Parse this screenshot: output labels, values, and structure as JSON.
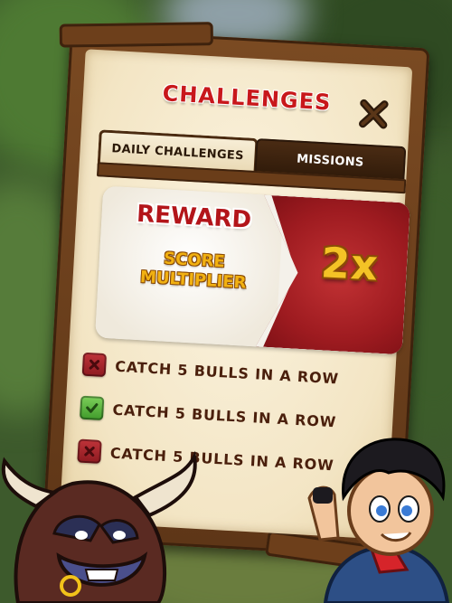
{
  "popup": {
    "title": "CHALLENGES",
    "close_icon": "close-x-icon"
  },
  "tabs": [
    {
      "label": "DAILY CHALLENGES",
      "active": true
    },
    {
      "label": "MISSIONS",
      "active": false
    }
  ],
  "reward": {
    "title": "REWARD",
    "description_line1": "SCORE",
    "description_line2": "MULTIPLIER",
    "multiplier": "2x"
  },
  "challenges": [
    {
      "text": "CATCH 5 BULLS IN A ROW",
      "status": "incomplete",
      "icon": "x-mark-icon"
    },
    {
      "text": "CATCH 5 BULLS IN A ROW",
      "status": "complete",
      "icon": "checkmark-icon"
    },
    {
      "text": "CATCH 5 BULLS IN A ROW",
      "status": "incomplete",
      "icon": "x-mark-icon"
    }
  ],
  "colors": {
    "title_red": "#c8171b",
    "wood_brown": "#5e3617",
    "reward_red": "#9e1b20",
    "gold": "#f4c326",
    "check_green": "#5cb43e"
  }
}
